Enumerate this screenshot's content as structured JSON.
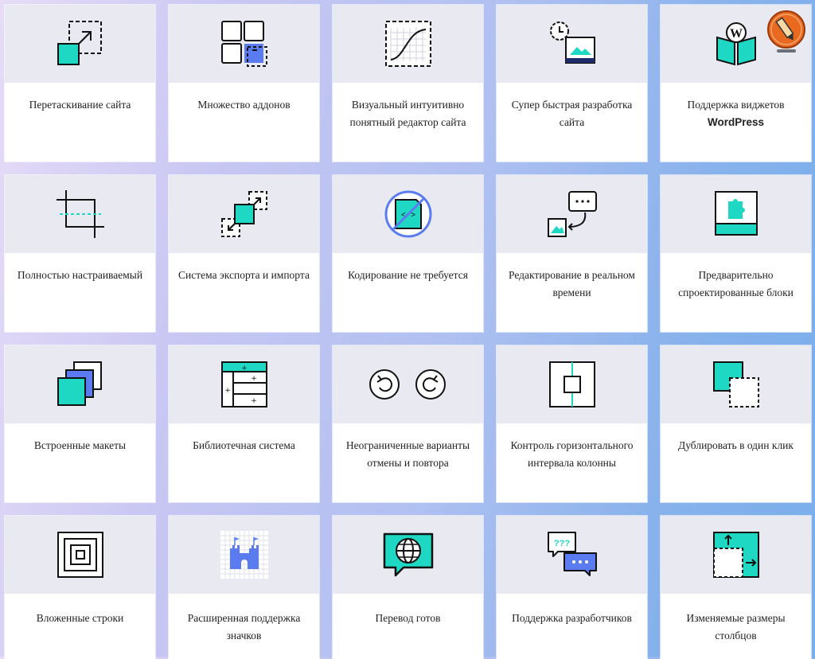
{
  "features": [
    {
      "label": "Перетаскивание сайта",
      "icon": "drag-drop-icon"
    },
    {
      "label": "Множество аддонов",
      "icon": "addons-grid-icon"
    },
    {
      "label": "Визуальный интуитивно понятный редактор сайта",
      "icon": "visual-editor-curve-icon"
    },
    {
      "label": "Супер быстрая разработка сайта",
      "icon": "fast-development-icon"
    },
    {
      "label_prefix": "Поддержка виджетов",
      "label_bold": "WordPress",
      "icon": "wordpress-book-icon"
    },
    {
      "label": "Полностью настраиваемый",
      "icon": "crop-customize-icon"
    },
    {
      "label": "Система экспорта и импорта",
      "icon": "export-import-icon"
    },
    {
      "label": "Кодирование не требуется",
      "icon": "no-code-icon"
    },
    {
      "label": "Редактирование в реальном времени",
      "icon": "realtime-edit-icon"
    },
    {
      "label": "Предварительно спроектированные блоки",
      "icon": "predesigned-block-icon"
    },
    {
      "label": "Встроенные макеты",
      "icon": "layouts-stack-icon"
    },
    {
      "label": "Библиотечная система",
      "icon": "library-system-icon"
    },
    {
      "label": "Неограниченные варианты отмены и повтора",
      "icon": "undo-redo-icon"
    },
    {
      "label": "Контроль горизонтального интервала колонны",
      "icon": "column-gap-icon"
    },
    {
      "label": "Дублировать в один клик",
      "icon": "duplicate-icon"
    },
    {
      "label": "Вложенные строки",
      "icon": "nested-rows-icon"
    },
    {
      "label": "Расширенная поддержка значков",
      "icon": "icon-support-castle-icon"
    },
    {
      "label": "Перевод готов",
      "icon": "translation-globe-icon"
    },
    {
      "label": "Поддержка разработчиков",
      "icon": "developer-support-chat-icon"
    },
    {
      "label": "Изменяемые размеры столбцов",
      "icon": "resize-columns-icon"
    }
  ],
  "wordpress_badge": "W",
  "colors": {
    "teal": "#1fd8c3",
    "blue": "#5b7cf0",
    "dark": "#111111",
    "panel": "#e9eaf1",
    "badge": "#e8691f"
  }
}
